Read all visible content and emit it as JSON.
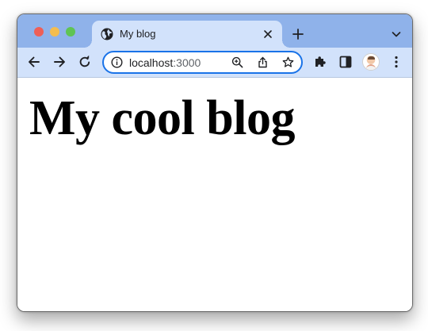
{
  "browser": {
    "tab": {
      "title": "My blog",
      "favicon": "globe-icon"
    },
    "address_bar": {
      "host": "localhost",
      "port": ":3000"
    },
    "colors": {
      "tabstrip": "#8fb2ea",
      "toolbar": "#d2e2fb",
      "omnibox_border": "#1a73e8"
    },
    "icons": {
      "back": "back-arrow-icon",
      "forward": "forward-arrow-icon",
      "reload": "reload-icon",
      "info": "info-icon",
      "zoom": "zoom-icon",
      "share": "share-icon",
      "bookmark": "star-icon",
      "extensions": "puzzle-icon",
      "side_panel": "side-panel-icon",
      "menu": "kebab-menu-icon",
      "new_tab": "plus-icon",
      "tab_search": "chevron-down-icon",
      "close_tab": "close-icon"
    }
  },
  "page": {
    "heading": "My cool blog"
  }
}
